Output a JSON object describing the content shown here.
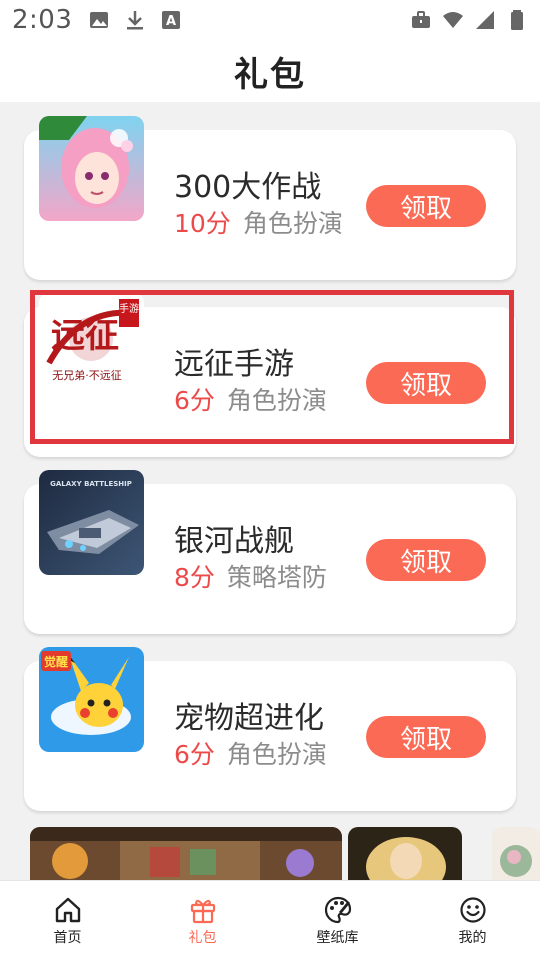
{
  "status_bar": {
    "time": "2:03",
    "left_icons": [
      "image-icon",
      "download-icon",
      "a-box-icon"
    ],
    "right_icons": [
      "briefcase-icon",
      "wifi-icon",
      "signal-icon",
      "battery-icon"
    ]
  },
  "header": {
    "title": "礼包"
  },
  "games": [
    {
      "name": "300大作战",
      "score": "10分",
      "genre": "角色扮演",
      "button": "领取",
      "icon": "anime-girl-game-icon"
    },
    {
      "name": "远征手游",
      "score": "6分",
      "genre": "角色扮演",
      "button": "领取",
      "icon": "yuanzheng-logo-icon",
      "logo_text": "远征",
      "logo_sub": "无兄弟·不远征",
      "logo_tag": "手游"
    },
    {
      "name": "银河战舰",
      "score": "8分",
      "genre": "策略塔防",
      "button": "领取",
      "icon": "spaceship-game-icon",
      "logo_text": "GALAXY BATTLESHIP"
    },
    {
      "name": "宠物超进化",
      "score": "6分",
      "genre": "角色扮演",
      "button": "领取",
      "icon": "pikachu-game-icon",
      "logo_tag": "觉醒"
    }
  ],
  "bottom_nav": [
    {
      "label": "首页",
      "icon": "home-icon",
      "active": false
    },
    {
      "label": "礼包",
      "icon": "gift-icon",
      "active": true
    },
    {
      "label": "壁纸库",
      "icon": "palette-icon",
      "active": false
    },
    {
      "label": "我的",
      "icon": "smiley-icon",
      "active": false
    }
  ],
  "colors": {
    "accent": "#fb6a55",
    "score": "#ec4a4a",
    "highlight": "#e0373f",
    "background": "#f1f1f1"
  }
}
